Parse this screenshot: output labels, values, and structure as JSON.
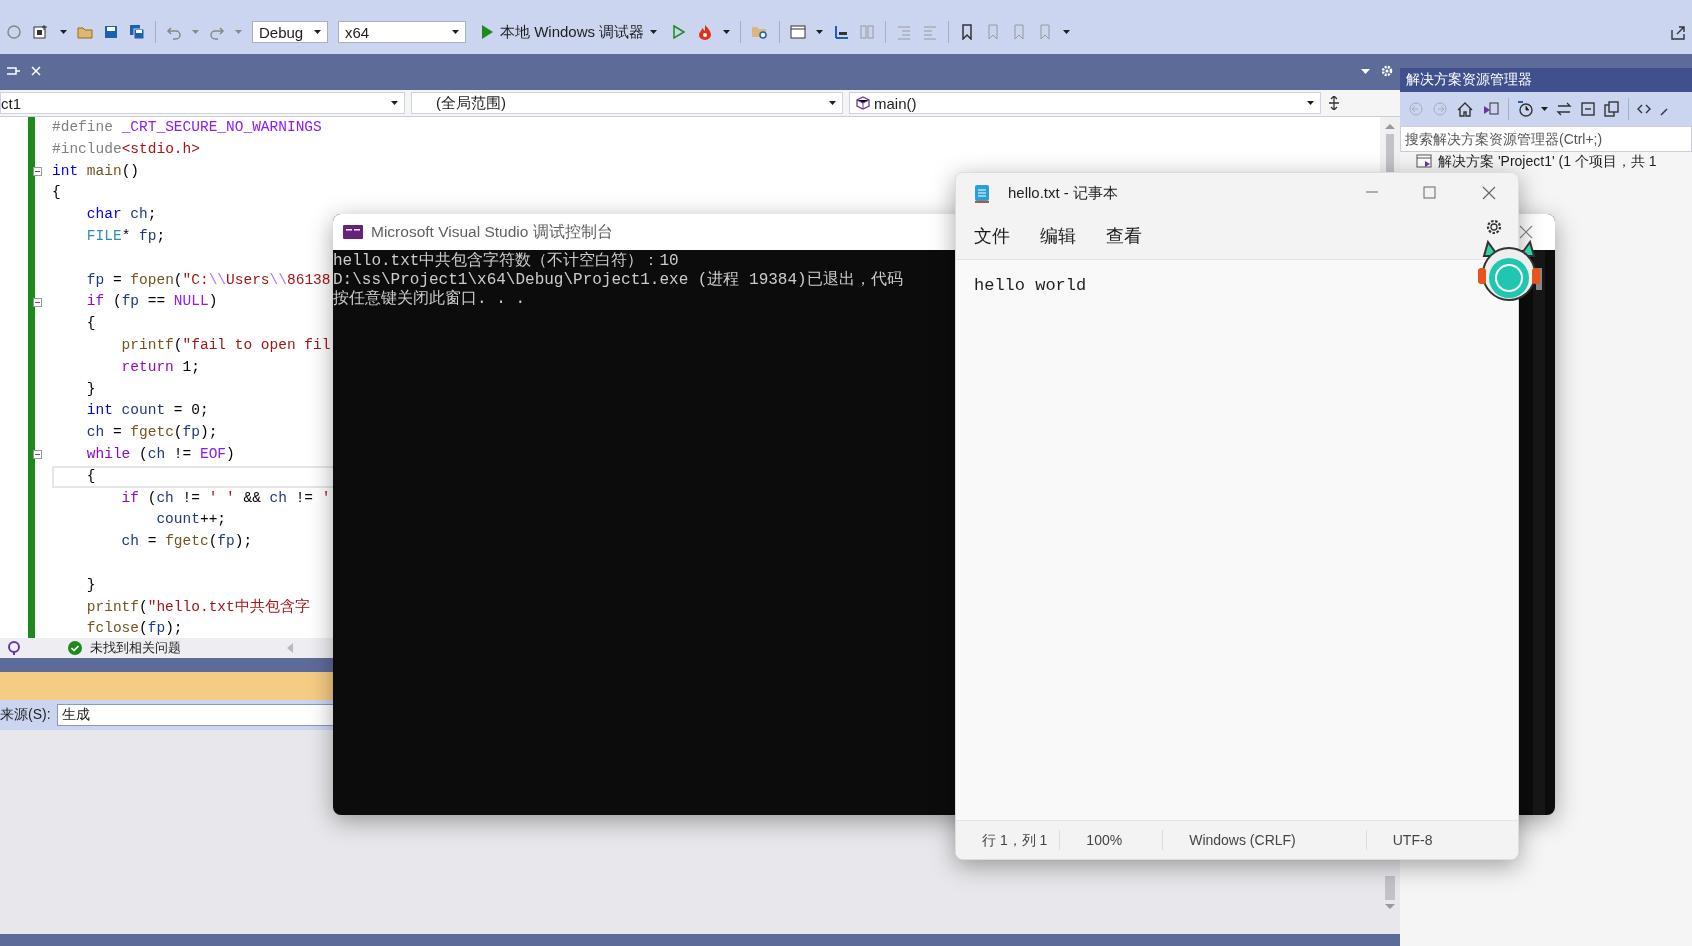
{
  "toolbar": {
    "configuration": "Debug",
    "platform": "x64",
    "debugger": "本地 Windows 调试器"
  },
  "editor": {
    "navigation": {
      "project": "ct1",
      "scope": "(全局范围)",
      "member": "main()"
    },
    "lines": [
      {
        "fold": false,
        "current": false,
        "tokens": [
          {
            "kind": "preprocessor",
            "text": "#define "
          },
          {
            "kind": "macro",
            "text": "_CRT_SECURE_NO_WARNINGS"
          }
        ]
      },
      {
        "fold": false,
        "current": false,
        "tokens": [
          {
            "kind": "preprocessor",
            "text": "#include"
          },
          {
            "kind": "string",
            "text": "<stdio.h>"
          }
        ]
      },
      {
        "fold": true,
        "current": false,
        "tokens": [
          {
            "kind": "keyword",
            "text": "int"
          },
          {
            "kind": "function",
            "text": " main"
          },
          {
            "kind": "plain",
            "text": "()"
          }
        ]
      },
      {
        "fold": false,
        "current": false,
        "tokens": [
          {
            "kind": "plain",
            "text": "{"
          }
        ]
      },
      {
        "fold": false,
        "current": false,
        "tokens": [
          {
            "kind": "keyword",
            "text": "    char"
          },
          {
            "kind": "variable",
            "text": " ch"
          },
          {
            "kind": "plain",
            "text": ";"
          }
        ]
      },
      {
        "fold": false,
        "current": false,
        "tokens": [
          {
            "kind": "type",
            "text": "    FILE"
          },
          {
            "kind": "plain",
            "text": "*"
          },
          {
            "kind": "variable",
            "text": " fp"
          },
          {
            "kind": "plain",
            "text": ";"
          }
        ]
      },
      {
        "fold": false,
        "current": false
      },
      {
        "fold": false,
        "current": false,
        "tokens": [
          {
            "kind": "variable",
            "text": "    fp"
          },
          {
            "kind": "plain",
            "text": " = "
          },
          {
            "kind": "function",
            "text": "fopen"
          },
          {
            "kind": "plain",
            "text": "("
          },
          {
            "kind": "string",
            "text": "\"C:"
          },
          {
            "kind": "escape",
            "text": "\\\\"
          },
          {
            "kind": "string",
            "text": "Users"
          },
          {
            "kind": "escape",
            "text": "\\\\"
          },
          {
            "kind": "string",
            "text": "86138"
          }
        ]
      },
      {
        "fold": true,
        "current": false,
        "tokens": [
          {
            "kind": "control",
            "text": "    if"
          },
          {
            "kind": "plain",
            "text": " ("
          },
          {
            "kind": "variable",
            "text": "fp"
          },
          {
            "kind": "plain",
            "text": " == "
          },
          {
            "kind": "macro",
            "text": "NULL"
          },
          {
            "kind": "plain",
            "text": ")"
          }
        ]
      },
      {
        "fold": false,
        "current": false,
        "tokens": [
          {
            "kind": "plain",
            "text": "    {"
          }
        ]
      },
      {
        "fold": false,
        "current": false,
        "tokens": [
          {
            "kind": "function",
            "text": "        printf"
          },
          {
            "kind": "plain",
            "text": "("
          },
          {
            "kind": "string",
            "text": "\"fail to open fil"
          }
        ]
      },
      {
        "fold": false,
        "current": false,
        "tokens": [
          {
            "kind": "control",
            "text": "        return"
          },
          {
            "kind": "plain",
            "text": " 1;"
          }
        ]
      },
      {
        "fold": false,
        "current": false,
        "tokens": [
          {
            "kind": "plain",
            "text": "    }"
          }
        ]
      },
      {
        "fold": false,
        "current": false,
        "tokens": [
          {
            "kind": "keyword",
            "text": "    int"
          },
          {
            "kind": "variable",
            "text": " count"
          },
          {
            "kind": "plain",
            "text": " = 0;"
          }
        ]
      },
      {
        "fold": false,
        "current": false,
        "tokens": [
          {
            "kind": "variable",
            "text": "    ch"
          },
          {
            "kind": "plain",
            "text": " = "
          },
          {
            "kind": "function",
            "text": "fgetc"
          },
          {
            "kind": "plain",
            "text": "("
          },
          {
            "kind": "variable",
            "text": "fp"
          },
          {
            "kind": "plain",
            "text": ");"
          }
        ]
      },
      {
        "fold": true,
        "current": false,
        "tokens": [
          {
            "kind": "control",
            "text": "    while"
          },
          {
            "kind": "plain",
            "text": " ("
          },
          {
            "kind": "variable",
            "text": "ch"
          },
          {
            "kind": "plain",
            "text": " != "
          },
          {
            "kind": "macro",
            "text": "EOF"
          },
          {
            "kind": "plain",
            "text": ")"
          }
        ]
      },
      {
        "fold": false,
        "current": true,
        "tokens": [
          {
            "kind": "plain",
            "text": "    {"
          }
        ]
      },
      {
        "fold": false,
        "current": false,
        "tokens": [
          {
            "kind": "control",
            "text": "        if"
          },
          {
            "kind": "plain",
            "text": " ("
          },
          {
            "kind": "variable",
            "text": "ch"
          },
          {
            "kind": "plain",
            "text": " != "
          },
          {
            "kind": "string",
            "text": "' '"
          },
          {
            "kind": "plain",
            "text": " && "
          },
          {
            "kind": "variable",
            "text": "ch"
          },
          {
            "kind": "plain",
            "text": " != "
          },
          {
            "kind": "string",
            "text": "'"
          }
        ]
      },
      {
        "fold": false,
        "current": false,
        "tokens": [
          {
            "kind": "variable",
            "text": "            count"
          },
          {
            "kind": "plain",
            "text": "++;"
          }
        ]
      },
      {
        "fold": false,
        "current": false,
        "tokens": [
          {
            "kind": "variable",
            "text": "        ch"
          },
          {
            "kind": "plain",
            "text": " = "
          },
          {
            "kind": "function",
            "text": "fgetc"
          },
          {
            "kind": "plain",
            "text": "("
          },
          {
            "kind": "variable",
            "text": "fp"
          },
          {
            "kind": "plain",
            "text": ");"
          }
        ]
      },
      {
        "fold": false,
        "current": false
      },
      {
        "fold": false,
        "current": false,
        "tokens": [
          {
            "kind": "plain",
            "text": "    }"
          }
        ]
      },
      {
        "fold": false,
        "current": false,
        "tokens": [
          {
            "kind": "function",
            "text": "    printf"
          },
          {
            "kind": "plain",
            "text": "("
          },
          {
            "kind": "string",
            "text": "\"hello.txt中共包含字"
          }
        ]
      },
      {
        "fold": false,
        "current": false,
        "tokens": [
          {
            "kind": "function",
            "text": "    fclose"
          },
          {
            "kind": "plain",
            "text": "("
          },
          {
            "kind": "variable",
            "text": "fp"
          },
          {
            "kind": "plain",
            "text": ");"
          }
        ]
      }
    ],
    "status": "未找到相关问题"
  },
  "output": {
    "source_label": "来源(S):",
    "source_value": "生成"
  },
  "solution_explorer": {
    "title": "解决方案资源管理器",
    "search_placeholder": "搜索解决方案资源管理器(Ctrl+;)",
    "tree": [
      {
        "label": "解决方案 'Project1' (1 个项目，共 1"
      }
    ]
  },
  "console": {
    "title": "Microsoft Visual Studio 调试控制台",
    "lines": [
      "hello.txt中共包含字符数（不计空白符）：10",
      "D:\\ss\\Project1\\x64\\Debug\\Project1.exe (进程 19384)已退出，代码",
      "按任意键关闭此窗口. . ."
    ]
  },
  "notepad": {
    "title": "hello.txt - 记事本",
    "menu": [
      "文件",
      "编辑",
      "查看"
    ],
    "content": "hello world",
    "status": [
      "行 1，列 1",
      "100%",
      "Windows (CRLF)",
      "UTF-8"
    ]
  }
}
